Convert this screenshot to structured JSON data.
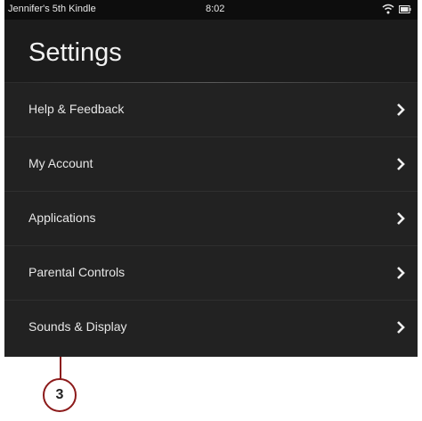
{
  "status_bar": {
    "device_name": "Jennifer's 5th Kindle",
    "time": "8:02",
    "icons": [
      "wifi-icon",
      "battery-icon"
    ]
  },
  "header": {
    "title": "Settings"
  },
  "settings_list": {
    "items": [
      {
        "label": "Help & Feedback"
      },
      {
        "label": "My Account"
      },
      {
        "label": "Applications"
      },
      {
        "label": "Parental Controls"
      },
      {
        "label": "Sounds & Display"
      }
    ],
    "chevron_icon": "chevron-right-icon"
  },
  "callout": {
    "number": "3"
  },
  "colors": {
    "background": "#222222",
    "status_bar": "#0d0d0d",
    "text": "#e6e6e6",
    "callout": "#8c1a1a"
  }
}
